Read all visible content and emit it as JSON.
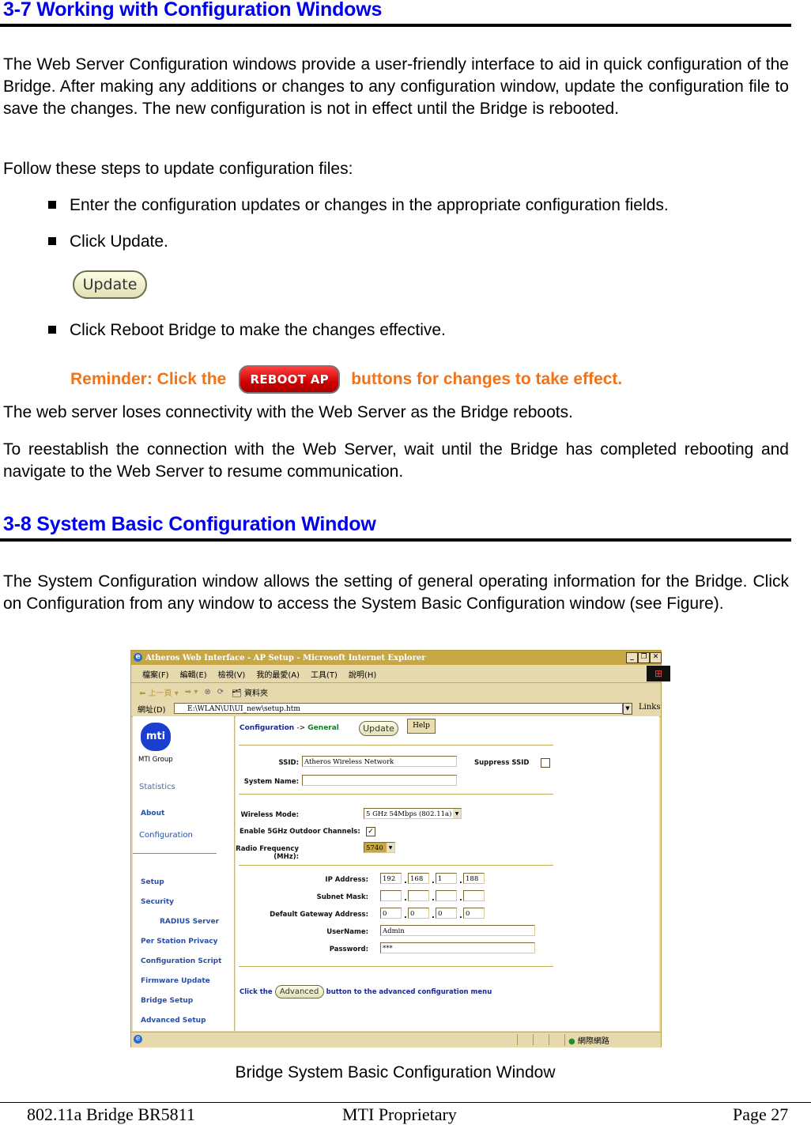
{
  "section1": {
    "heading": "3-7 Working with Configuration Windows",
    "paragraph": "The Web Server Configuration windows provide a user-friendly interface to aid in quick configuration of the Bridge. After making any additions or changes to any configuration window, update the configuration file to save the changes. The new configuration is not in effect until the Bridge is rebooted.",
    "steps_intro": "Follow these steps to update configuration files:",
    "bullets": [
      "Enter the configuration updates or changes in the appropriate configuration fields.",
      "Click Update.",
      "Click Reboot Bridge to make the changes effective."
    ],
    "update_button": "Update",
    "reminder_before": "Reminder: Click the",
    "reboot_button": "REBOOT AP",
    "reminder_after": "buttons for changes to take effect.",
    "para2": "The web server loses connectivity with the Web Server as the Bridge reboots.",
    "para3": "To reestablish the connection with the Web Server, wait until the Bridge has completed rebooting and navigate to the Web Server to resume communication."
  },
  "section2": {
    "heading": "3-8 System Basic Configuration Window",
    "paragraph": "The System Configuration window allows the setting of general operating information for the Bridge. Click on Configuration from any window to access the System Basic Configuration window (see Figure).",
    "caption": "Bridge System Basic Configuration Window"
  },
  "browser": {
    "title": "Atheros Web Interface - AP Setup - Microsoft Internet Explorer",
    "menu": [
      "檔案(F)",
      "編輯(E)",
      "檢視(V)",
      "我的最愛(A)",
      "工具(T)",
      "說明(H)"
    ],
    "toolbar": {
      "back": "上一頁",
      "folders": "資料夾"
    },
    "address_label": "網址(D)",
    "address": "E:\\WLAN\\UI\\UI_new\\setup.htm",
    "links": "Links",
    "status_zone": "網際網路",
    "sidebar": {
      "brand": "MTI Group",
      "items": [
        "Statistics",
        "About",
        "Configuration"
      ],
      "sub_items": [
        "Setup",
        "Security",
        "RADIUS Server",
        "Per Station Privacy",
        "Configuration Script",
        "Firmware Update",
        "Bridge Setup",
        "Advanced Setup"
      ]
    },
    "content": {
      "breadcrumb_parent": "Configuration",
      "breadcrumb_sep": "->",
      "breadcrumb_current": "General",
      "update_button": "Update",
      "help_button": "Help",
      "ssid_label": "SSID:",
      "ssid_value": "Atheros Wireless Network",
      "suppress_ssid_label": "Suppress SSID",
      "suppress_ssid_checked": false,
      "system_name_label": "System Name:",
      "system_name_value": "",
      "wireless_mode_label": "Wireless Mode:",
      "wireless_mode_value": "5 GHz 54Mbps (802.11a)",
      "outdoor_label": "Enable 5GHz Outdoor Channels:",
      "outdoor_checked": true,
      "radio_freq_label": "Radio Frequency (MHz):",
      "radio_freq_value": "5740",
      "ip_label": "IP Address:",
      "ip": [
        "192",
        "168",
        "1",
        "188"
      ],
      "subnet_label": "Subnet Mask:",
      "subnet": [
        "",
        "",
        "",
        ""
      ],
      "gateway_label": "Default Gateway Address:",
      "gateway": [
        "0",
        "0",
        "0",
        "0"
      ],
      "username_label": "UserName:",
      "username_value": "Admin",
      "password_label": "Password:",
      "password_value": "***",
      "advanced_before": "Click the",
      "advanced_button": "Advanced",
      "advanced_after": "button to the advanced configuration menu"
    }
  },
  "footer": {
    "left": "802.11a Bridge BR5811",
    "center": "MTI Proprietary",
    "right": "Page 27"
  }
}
